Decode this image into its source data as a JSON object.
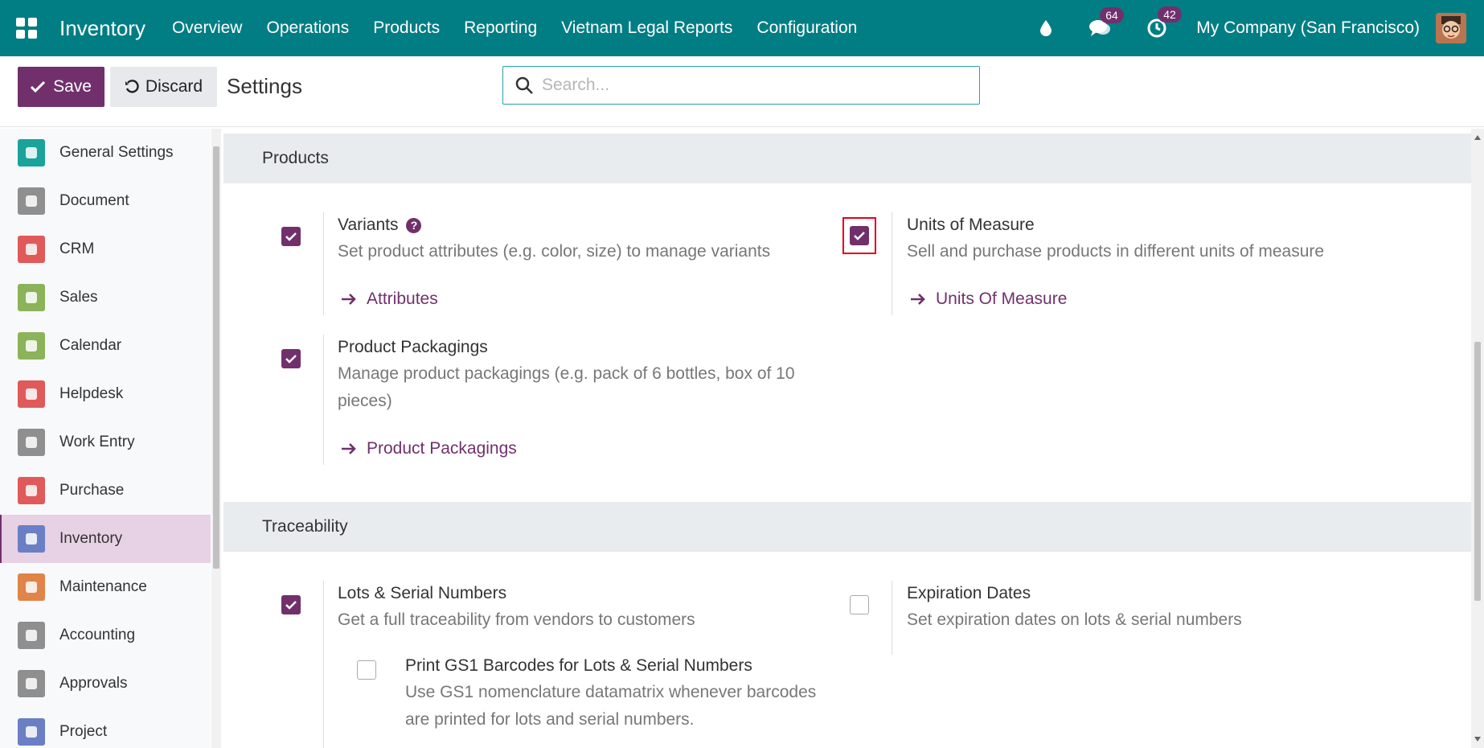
{
  "navbar": {
    "app_name": "Inventory",
    "menu": [
      "Overview",
      "Operations",
      "Products",
      "Reporting",
      "Vietnam Legal Reports",
      "Configuration"
    ],
    "messages_count": "64",
    "activities_count": "42",
    "company": "My Company (San Francisco)"
  },
  "control": {
    "save_label": "Save",
    "discard_label": "Discard",
    "title": "Settings",
    "search_placeholder": "Search..."
  },
  "sidebar": {
    "items": [
      {
        "label": "General Settings",
        "color": "#1aa39a"
      },
      {
        "label": "Document",
        "color": "#8f8f8f"
      },
      {
        "label": "CRM",
        "color": "#e05a5a"
      },
      {
        "label": "Sales",
        "color": "#8bb35a"
      },
      {
        "label": "Calendar",
        "color": "#8bb35a"
      },
      {
        "label": "Helpdesk",
        "color": "#e05a5a"
      },
      {
        "label": "Work Entry",
        "color": "#8f8f8f"
      },
      {
        "label": "Purchase",
        "color": "#e05a5a"
      },
      {
        "label": "Inventory",
        "color": "#6a7fc4"
      },
      {
        "label": "Maintenance",
        "color": "#e0844a"
      },
      {
        "label": "Accounting",
        "color": "#8f8f8f"
      },
      {
        "label": "Approvals",
        "color": "#8f8f8f"
      },
      {
        "label": "Project",
        "color": "#6a7fc4"
      }
    ],
    "active_index": 8
  },
  "sections": {
    "products": {
      "header": "Products",
      "variants": {
        "title": "Variants",
        "desc": "Set product attributes (e.g. color, size) to manage variants",
        "link": "Attributes",
        "checked": true
      },
      "uom": {
        "title": "Units of Measure",
        "desc": "Sell and purchase products in different units of measure",
        "link": "Units Of Measure",
        "checked": true
      },
      "packagings": {
        "title": "Product Packagings",
        "desc": "Manage product packagings (e.g. pack of 6 bottles, box of 10 pieces)",
        "link": "Product Packagings",
        "checked": true
      }
    },
    "traceability": {
      "header": "Traceability",
      "lots": {
        "title": "Lots & Serial Numbers",
        "desc": "Get a full traceability from vendors to customers",
        "checked": true
      },
      "gs1": {
        "title": "Print GS1 Barcodes for Lots & Serial Numbers",
        "desc": "Use GS1 nomenclature datamatrix whenever barcodes are printed for lots and serial numbers.",
        "checked": false
      },
      "expiration": {
        "title": "Expiration Dates",
        "desc": "Set expiration dates on lots & serial numbers",
        "checked": false
      }
    }
  },
  "colors": {
    "navbar": "#017e84",
    "primary": "#71306c",
    "highlight": "#e3001b"
  }
}
